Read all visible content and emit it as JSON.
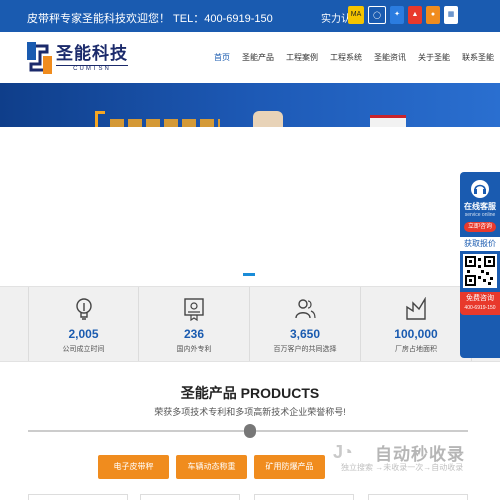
{
  "topbar": {
    "welcome": "皮带秤专家圣能科技欢迎您！ TEL：400-6919-150",
    "cert_label": "实力认证",
    "cert_icons": [
      "ma-badge-icon",
      "cnas-icon",
      "cma-icon",
      "flame-icon",
      "medal-icon",
      "ce-icon"
    ]
  },
  "logo": {
    "cn": "圣能科技",
    "en": "CUMTSN"
  },
  "nav": {
    "items": [
      "首页",
      "圣能产品",
      "工程案例",
      "工程系统",
      "圣能资讯",
      "关于圣能",
      "联系圣能"
    ],
    "active_index": 0
  },
  "banner": {
    "slide_count": 1,
    "active_slide": 0
  },
  "stats": [
    {
      "icon": "lightbulb-icon",
      "value": "2,005",
      "label": "公司成立时间"
    },
    {
      "icon": "certificate-icon",
      "value": "236",
      "label": "国内外专利"
    },
    {
      "icon": "users-icon",
      "value": "3,650",
      "label": "百万客户的共同选择"
    },
    {
      "icon": "building-icon",
      "value": "100,000",
      "label": "厂房占地面积"
    }
  ],
  "products": {
    "title": "圣能产品  PRODUCTS",
    "subtitle": "荣获多项技术专利和多项高新技术企业荣誉称号!",
    "categories": [
      "电子皮带秤",
      "车辆动态称重",
      "矿用防爆产品"
    ]
  },
  "side_widget": {
    "online": "在线客服",
    "online_en": "service online",
    "consult": "立即咨询",
    "quote": "获取报价",
    "free": "免费咨询",
    "phone": "400-6919-150"
  },
  "watermark": {
    "title": "自动秒收录",
    "slogan": "独立搜索 →未收录一次→自动收录"
  },
  "colors": {
    "primary": "#1a5bb0",
    "accent": "#f08c1e",
    "alert": "#e8392c"
  }
}
